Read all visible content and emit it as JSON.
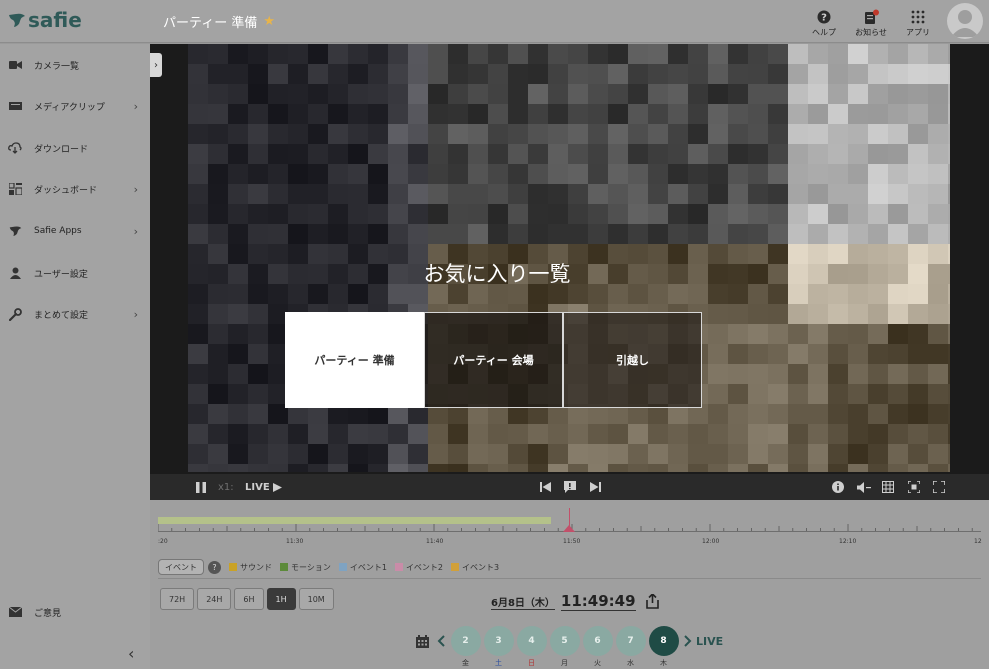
{
  "header": {
    "logo": "safie",
    "title": "パーティー 準備",
    "help_label": "ヘルプ",
    "news_label": "お知らせ",
    "apps_label": "アプリ"
  },
  "sidebar": {
    "items": [
      {
        "label": "カメラ一覧",
        "icon": "video-camera-icon",
        "chevron": false
      },
      {
        "label": "メディアクリップ",
        "icon": "clip-icon",
        "chevron": true
      },
      {
        "label": "ダウンロード",
        "icon": "cloud-download-icon",
        "chevron": false
      },
      {
        "label": "ダッシュボード",
        "icon": "dashboard-icon",
        "chevron": true
      },
      {
        "label": "Safie Apps",
        "icon": "safie-logo-icon",
        "chevron": true
      },
      {
        "label": "ユーザー設定",
        "icon": "user-icon",
        "chevron": false
      },
      {
        "label": "まとめて設定",
        "icon": "wrench-icon",
        "chevron": true
      }
    ],
    "feedback_label": "ご意見"
  },
  "favorites": {
    "title": "お気に入り一覧",
    "cards": [
      "パーティー 準備",
      "パーティー 会場",
      "引越し"
    ]
  },
  "player": {
    "speed": "x1:",
    "live": "LIVE"
  },
  "timeline": {
    "labels": [
      ":20",
      "11:30",
      "11:40",
      "11:50",
      "12:00",
      "12:10",
      "12"
    ]
  },
  "legend": {
    "event_button": "イベント",
    "items": [
      {
        "label": "サウンド",
        "color": "#c9a227"
      },
      {
        "label": "モーション",
        "color": "#5c8a3a"
      },
      {
        "label": "イベント1",
        "color": "#7fa3c2"
      },
      {
        "label": "イベント2",
        "color": "#c98ca8"
      },
      {
        "label": "イベント3",
        "color": "#d1a03a"
      }
    ]
  },
  "ranges": [
    {
      "label": "72H",
      "active": false
    },
    {
      "label": "24H",
      "active": false
    },
    {
      "label": "6H",
      "active": false
    },
    {
      "label": "1H",
      "active": true
    },
    {
      "label": "10M",
      "active": false
    }
  ],
  "datetime": {
    "date": "6月8日（木）",
    "time": "11:49:49"
  },
  "days": [
    {
      "num": "2",
      "wd": "金",
      "type": "",
      "active": false
    },
    {
      "num": "3",
      "wd": "土",
      "type": "sat",
      "active": false
    },
    {
      "num": "4",
      "wd": "日",
      "type": "sun",
      "active": false
    },
    {
      "num": "5",
      "wd": "月",
      "type": "",
      "active": false
    },
    {
      "num": "6",
      "wd": "火",
      "type": "",
      "active": false
    },
    {
      "num": "7",
      "wd": "水",
      "type": "",
      "active": false
    },
    {
      "num": "8",
      "wd": "木",
      "type": "",
      "active": true
    }
  ],
  "live_link": "LIVE",
  "colors": {
    "brand": "#2f5a58",
    "accent_day": "#1f4b45",
    "cursor": "#c2506a",
    "star": "#e8b44a"
  }
}
